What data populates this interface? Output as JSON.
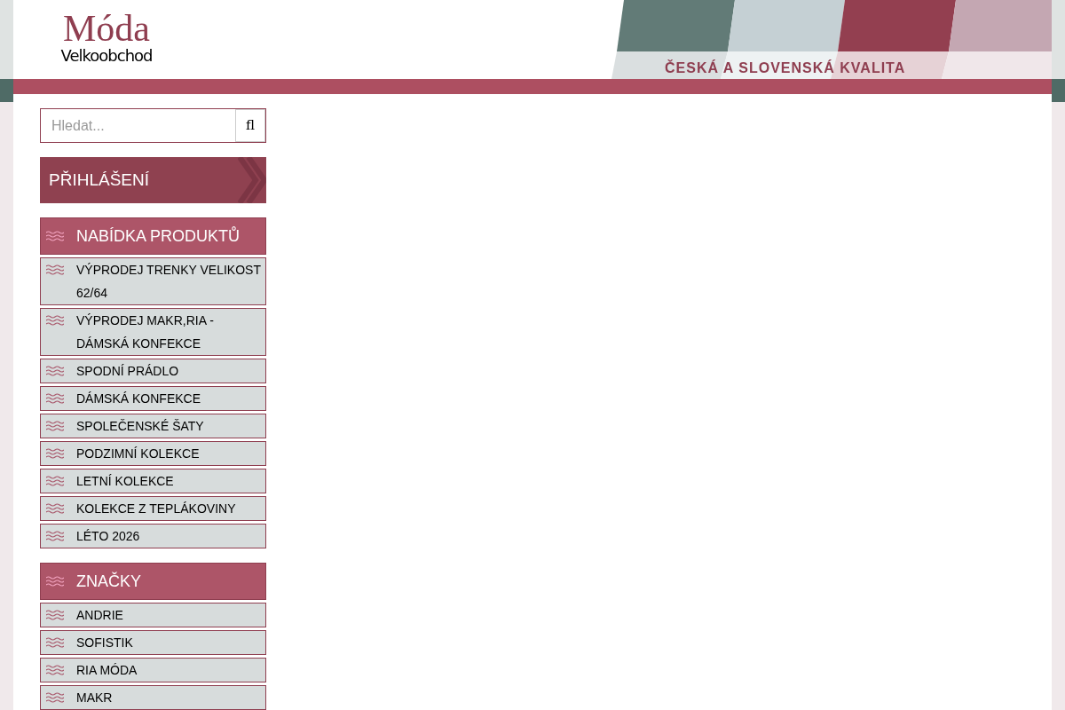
{
  "logo": {
    "title": "Móda",
    "subtitle": "Velkoobchod"
  },
  "tagline": "ČESKÁ A SLOVENSKÁ KVALITA",
  "search": {
    "placeholder": "Hledat...",
    "button": "fl"
  },
  "login": {
    "label": "PŘIHLÁŠENÍ"
  },
  "sections": [
    {
      "title": "NABÍDKA PRODUKTŮ",
      "items": [
        "VÝPRODEJ TRENKY VELIKOST 62/64",
        "VÝPRODEJ MAKR,RIA - DÁMSKÁ KONFEKCE",
        "SPODNÍ PRÁDLO",
        "DÁMSKÁ KONFEKCE",
        "SPOLEČENSKÉ ŠATY",
        "PODZIMNÍ KOLEKCE",
        "LETNÍ KOLEKCE",
        "KOLEKCE Z TEPLÁKOVINY",
        "LÉTO 2026"
      ]
    },
    {
      "title": "ZNAČKY",
      "items": [
        "ANDRIE",
        "SOFISTIK",
        "RIA MÓDA",
        "MAKR"
      ]
    }
  ]
}
